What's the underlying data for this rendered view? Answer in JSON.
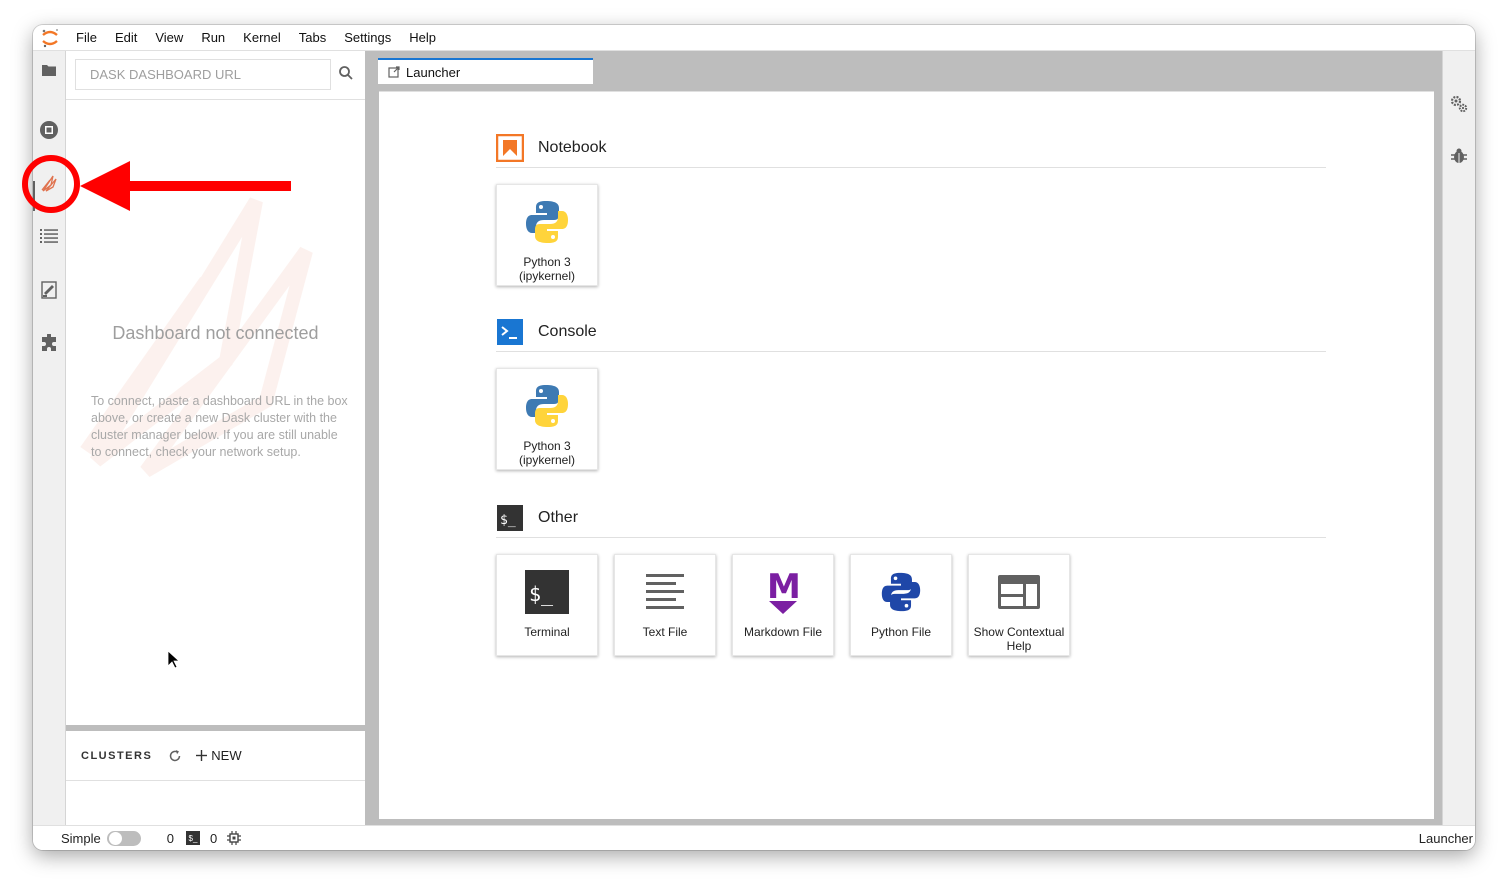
{
  "menu": [
    "File",
    "Edit",
    "View",
    "Run",
    "Kernel",
    "Tabs",
    "Settings",
    "Help"
  ],
  "left_panel": {
    "search_placeholder": "DASK DASHBOARD URL",
    "not_connected_title": "Dashboard not connected",
    "not_connected_desc": "To connect, paste a dashboard URL in the box above, or create a new Dask cluster with the cluster manager below. If you are still unable to connect, check your network setup.",
    "clusters_label": "CLUSTERS",
    "new_label": "NEW"
  },
  "tab": {
    "label": "Launcher"
  },
  "launcher": {
    "sections": [
      {
        "title": "Notebook",
        "cards": [
          "Python 3\n(ipykernel)"
        ]
      },
      {
        "title": "Console",
        "cards": [
          "Python 3\n(ipykernel)"
        ]
      },
      {
        "title": "Other",
        "cards": [
          "Terminal",
          "Text File",
          "Markdown File",
          "Python File",
          "Show Contextual Help"
        ]
      }
    ],
    "notebook_title": "Notebook",
    "console_title": "Console",
    "other_title": "Other",
    "nb_card": "Python 3 (ipykernel)",
    "console_card": "Python 3 (ipykernel)",
    "terminal": "Terminal",
    "text_file": "Text File",
    "markdown_file": "Markdown File",
    "python_file": "Python File",
    "contextual_help": "Show Contextual Help"
  },
  "status": {
    "simple_label": "Simple",
    "terminals_count": "0",
    "kernels_count": "0",
    "terminal_glyph": "$_",
    "right_label": "Launcher"
  },
  "colors": {
    "annotation": "#ff0000",
    "active_tab_border": "#1976d2",
    "notebook_icon": "#f37726",
    "console_icon": "#1976d2",
    "markdown_icon": "#7b1fa2",
    "python_blue": "#3e7ab3",
    "python_yellow": "#ffd43b"
  }
}
